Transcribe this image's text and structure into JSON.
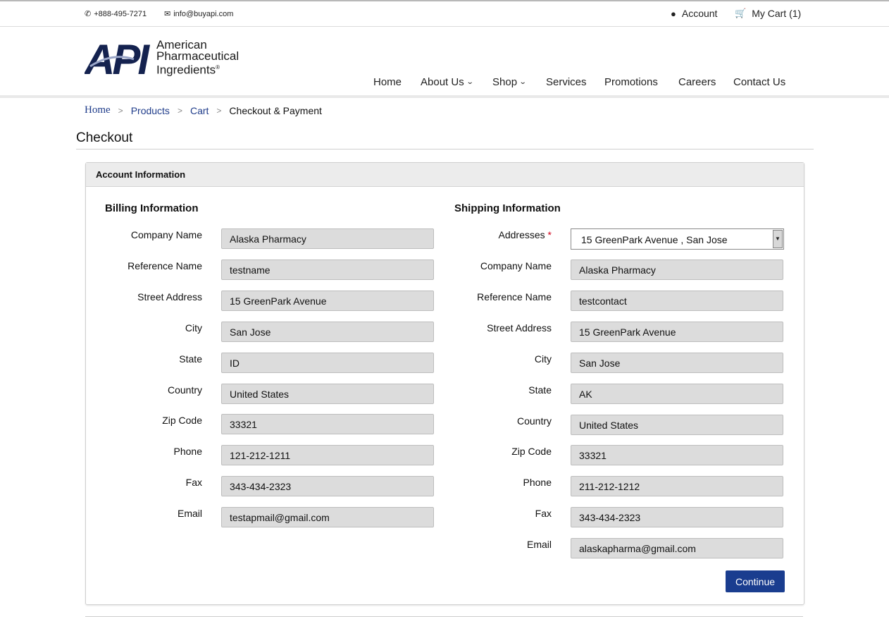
{
  "topbar": {
    "phone": "+888-495-7271",
    "email": "info@buyapi.com",
    "account_label": "Account",
    "cart_label": "My Cart (1)"
  },
  "logo": {
    "mark": "API",
    "line1": "American",
    "line2": "Pharmaceutical",
    "line3": "Ingredients",
    "reg": "®"
  },
  "nav": [
    "Home",
    "About Us",
    "Shop",
    "Services",
    "Promotions",
    "Careers",
    "Contact Us"
  ],
  "breadcrumb": {
    "home": "Home",
    "products": "Products",
    "cart": "Cart",
    "sep": ">",
    "current": "Checkout & Payment"
  },
  "page_title": "Checkout",
  "panel_title": "Account Information",
  "billing": {
    "title": "Billing Information",
    "fields": [
      {
        "label": "Company Name",
        "value": "Alaska Pharmacy"
      },
      {
        "label": "Reference Name",
        "value": "testname"
      },
      {
        "label": "Street Address",
        "value": "15 GreenPark Avenue"
      },
      {
        "label": "City",
        "value": "San Jose"
      },
      {
        "label": "State",
        "value": "ID"
      },
      {
        "label": "Country",
        "value": "United States"
      },
      {
        "label": "Zip Code",
        "value": "33321"
      },
      {
        "label": "Phone",
        "value": "121-212-1211"
      },
      {
        "label": "Fax",
        "value": "343-434-2323"
      },
      {
        "label": "Email",
        "value": "testapmail@gmail.com"
      }
    ]
  },
  "shipping": {
    "title": "Shipping Information",
    "address_label": "Addresses",
    "required_mark": "*",
    "address_selected": "15 GreenPark Avenue , San Jose",
    "fields": [
      {
        "label": "Company Name",
        "value": "Alaska Pharmacy"
      },
      {
        "label": "Reference Name",
        "value": "testcontact"
      },
      {
        "label": "Street Address",
        "value": "15 GreenPark Avenue"
      },
      {
        "label": "City",
        "value": "San Jose"
      },
      {
        "label": "State",
        "value": "AK"
      },
      {
        "label": "Country",
        "value": "United States"
      },
      {
        "label": "Zip Code",
        "value": "33321"
      },
      {
        "label": "Phone",
        "value": "211-212-1212"
      },
      {
        "label": "Fax",
        "value": "343-434-2323"
      },
      {
        "label": "Email",
        "value": "alaskapharma@gmail.com"
      }
    ]
  },
  "continue_label": "Continue",
  "colors": {
    "brand": "#1a3d8f",
    "link": "#1f3c8a",
    "field_bg": "#dcdcdc"
  }
}
